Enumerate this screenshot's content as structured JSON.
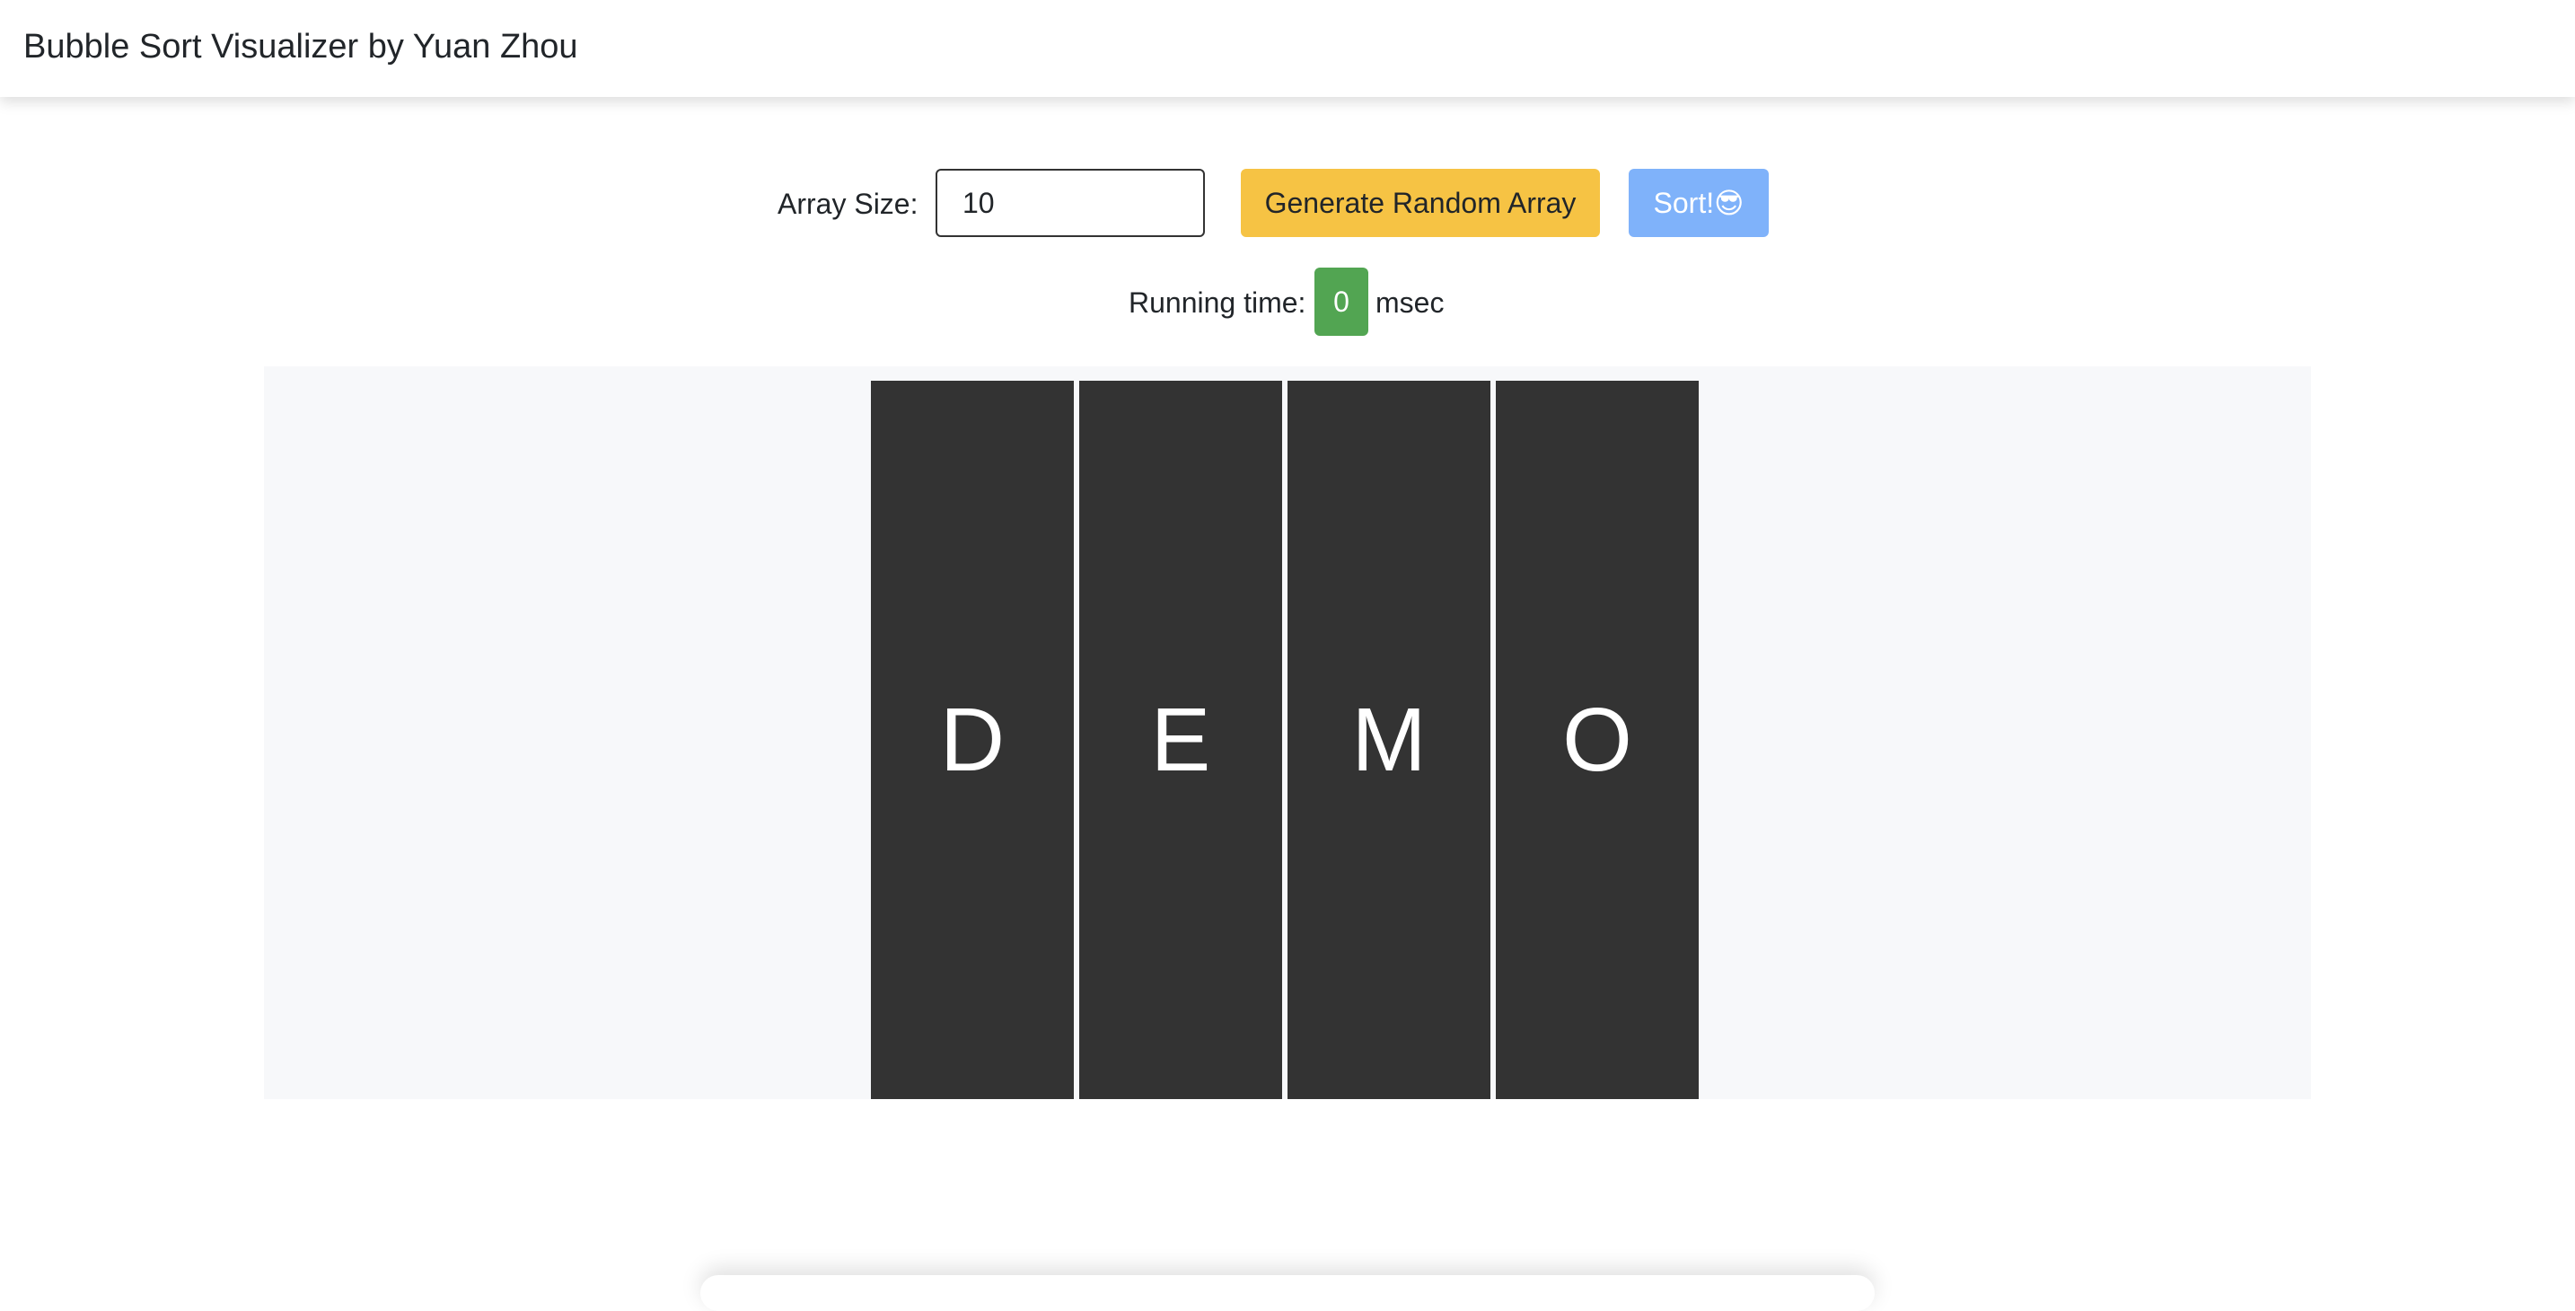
{
  "navbar": {
    "brand": "Bubble Sort Visualizer by Yuan Zhou"
  },
  "controls": {
    "array_size_label": "Array Size:",
    "array_size_value": "10",
    "generate_button": "Generate Random Array",
    "sort_button": "Sort!😎"
  },
  "runtime": {
    "label": "Running time:",
    "value": "0",
    "unit": "msec"
  },
  "colors": {
    "bar": "#333333",
    "stage_bg": "#f7f8fa",
    "warning": "#f6c344",
    "primary": "#7fb2fa",
    "success": "#52a552"
  },
  "bars": [
    {
      "label": "D"
    },
    {
      "label": "E"
    },
    {
      "label": "M"
    },
    {
      "label": "O"
    }
  ]
}
